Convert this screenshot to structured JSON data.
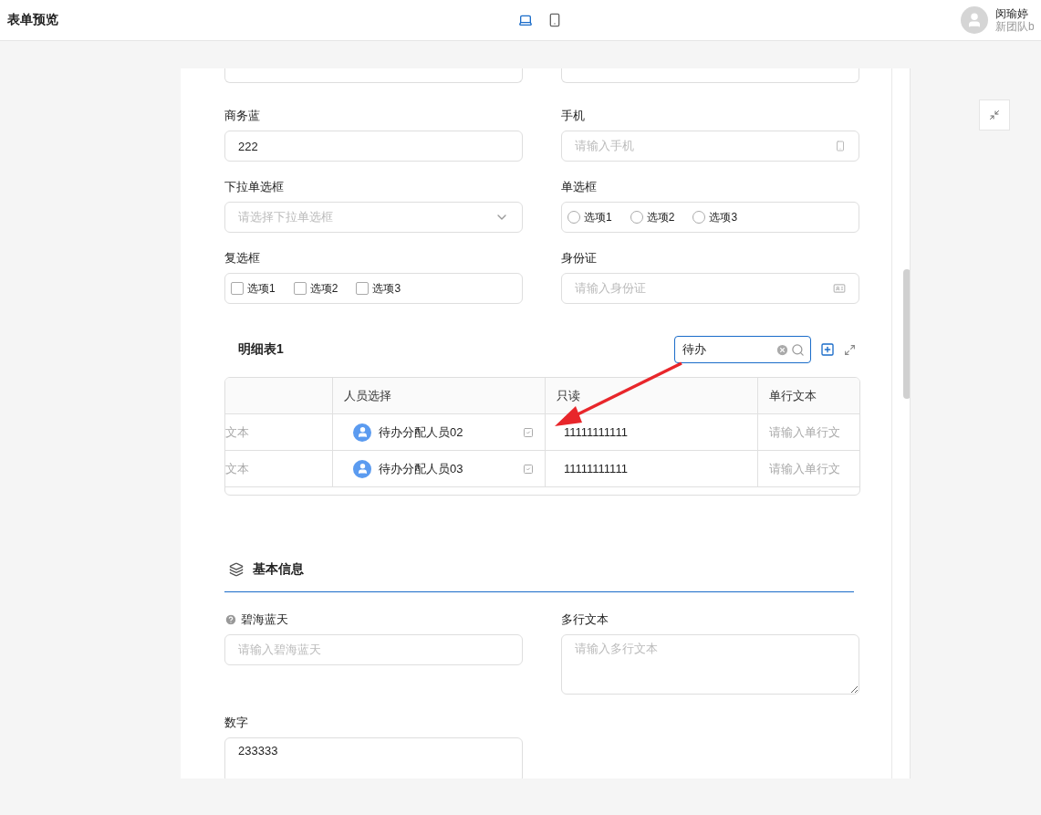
{
  "header": {
    "title": "表单预览",
    "devices": [
      {
        "kind": "desktop",
        "selected": true
      },
      {
        "kind": "mobile",
        "selected": false
      }
    ],
    "user": {
      "name": "闵瑜婷",
      "team": "新团队b"
    }
  },
  "form": {
    "rows": [
      {
        "fields": [
          {
            "kind": "partial"
          },
          {
            "kind": "partial"
          }
        ]
      },
      {
        "fields": [
          {
            "kind": "text",
            "label": "商务蓝",
            "value": "222"
          },
          {
            "kind": "phone",
            "label": "手机",
            "placeholder": "请输入手机"
          }
        ]
      },
      {
        "fields": [
          {
            "kind": "select",
            "label": "下拉单选框",
            "placeholder": "请选择下拉单选框"
          },
          {
            "kind": "radio",
            "label": "单选框",
            "options": [
              {
                "label": "选项1",
                "selected": false
              },
              {
                "label": "选项2",
                "selected": false
              },
              {
                "label": "选项3",
                "selected": false
              }
            ]
          }
        ]
      },
      {
        "fields": [
          {
            "kind": "checkbox",
            "label": "复选框",
            "options": [
              {
                "label": "选项1",
                "checked": false
              },
              {
                "label": "选项2",
                "checked": false
              },
              {
                "label": "选项3",
                "checked": false
              }
            ]
          },
          {
            "kind": "idcard",
            "label": "身份证",
            "placeholder": "请输入身份证"
          }
        ]
      }
    ]
  },
  "detail_table": {
    "title": "明细表1",
    "search": {
      "value": "待办"
    },
    "columns": [
      "",
      "人员选择",
      "只读",
      "单行文本"
    ],
    "rows": [
      {
        "cells": [
          "文本",
          "待办分配人员02",
          "11111111111",
          "请输入单行文"
        ]
      },
      {
        "cells": [
          "文本",
          "待办分配人员03",
          "11111111111",
          "请输入单行文"
        ]
      }
    ]
  },
  "section": {
    "title": "基本信息",
    "rows": [
      {
        "fields": [
          {
            "kind": "text",
            "label": "碧海蓝天",
            "help": true,
            "placeholder": "请输入碧海蓝天"
          },
          {
            "kind": "textarea",
            "label": "多行文本",
            "placeholder": "请输入多行文本"
          }
        ]
      },
      {
        "fields": [
          {
            "kind": "number",
            "label": "数字",
            "value": "233333"
          }
        ]
      }
    ]
  }
}
